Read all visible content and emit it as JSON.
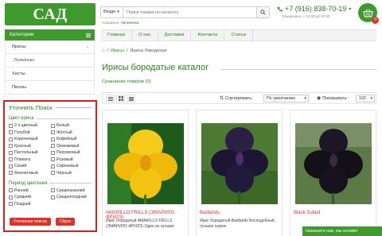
{
  "header": {
    "logo": "САД ИРИСОВ",
    "search_scope": "Везде",
    "search_placeholder": "Поиск товара по каталогу",
    "example_label": "Например:",
    "example_value": "Лилейники",
    "phone": "+7 (916) 838-70-19",
    "hours": "Ежедневно, с 10:00 до 20:00",
    "cart_count": "0"
  },
  "nav": [
    "Главная",
    "О нас",
    "Доставка",
    "Контакты",
    "Статьи"
  ],
  "sidebar": {
    "header": "Категории",
    "items": [
      {
        "label": "Ирисы",
        "sub": false,
        "chev": true
      },
      {
        "label": "Лилейники",
        "sub": true,
        "chev": false
      },
      {
        "label": "Хосты",
        "sub": false,
        "chev": false
      },
      {
        "label": "Пионы",
        "sub": false,
        "chev": false
      }
    ]
  },
  "filter": {
    "title": "Уточнить Поиск",
    "color_group": "Цвет ириса",
    "colors": [
      "2-х цветный",
      "Белый",
      "Голубой",
      "Жёлтый",
      "Коричневый",
      "Кофейный",
      "Красный",
      "Оранжевый",
      "Пастельный",
      "Персиковый",
      "Пликата",
      "Розовый",
      "Синий",
      "Сиреневый",
      "Фиолетовый",
      "Чёрный"
    ],
    "period_group": "Период цветения",
    "periods": [
      "Ранний",
      "Среднеранний",
      "Средний",
      "Среднепоздний",
      "Поздний"
    ],
    "apply_button": "Уточнение поиска",
    "reset_button": "Сброс"
  },
  "breadcrumb": [
    "Ирисы",
    "Ирисы бородатые"
  ],
  "page_title": "Ирисы бородатые каталог",
  "compare": "Сравнение товаров (0)",
  "toolbar": {
    "sort_label": "Сортировать:",
    "sort_value": "По умолчанию",
    "limit_label": "Показывать:",
    "limit_value": "102"
  },
  "products": [
    {
      "name": "AMARILLO FRILLS (ЭМАРИЛО ФРИЛЗ)",
      "desc": "Ирис бородатый AMARILLO FRILLS (ЭМАРИЛО ФРИЛЗ) Один из лучших",
      "color": "#f2c40f"
    },
    {
      "name": "Badlands",
      "desc": "Ирис бородатый Badlands Бесподобный, лучших серию",
      "color": "#221a3a"
    },
    {
      "name": "Black Suited",
      "desc": "",
      "color": "#141018"
    }
  ],
  "chat": "Напишите нам, мы онлайн!"
}
